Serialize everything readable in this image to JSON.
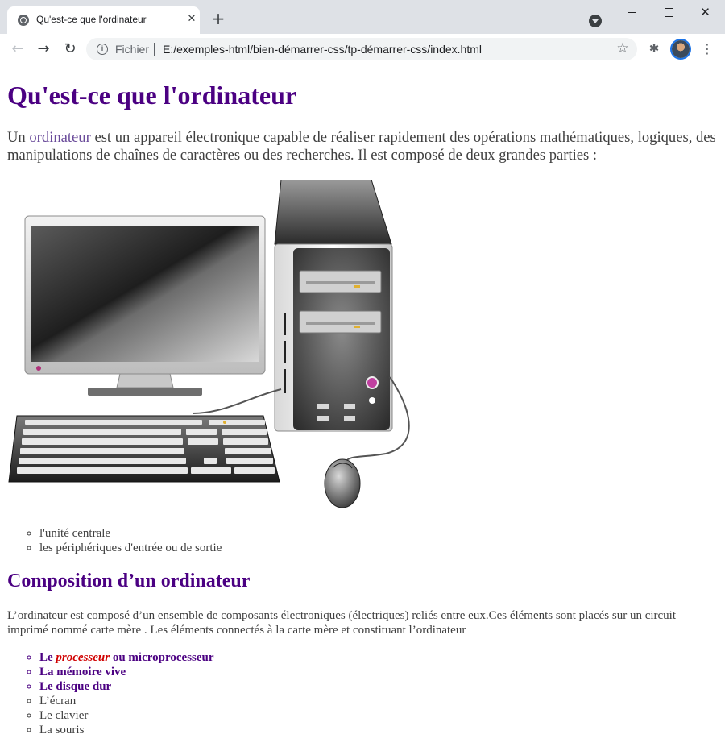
{
  "browser": {
    "tab_title": "Qu'est-ce que l'ordinateur",
    "tab_close": "✕",
    "new_tab": "+",
    "scheme_label": "Fichier",
    "url": "E:/exemples-html/bien-démarrer-css/tp-démarrer-css/index.html",
    "icons": {
      "back": "←",
      "forward": "→",
      "reload": "↻",
      "info": "i",
      "bookmark": "☆",
      "extensions": "✱",
      "menu": "⋮",
      "window_close": "✕"
    }
  },
  "page": {
    "title": "Qu'est-ce que l'ordinateur",
    "intro": {
      "prefix": "Un ",
      "link": "ordinateur",
      "suffix": " est un appareil électronique capable de réaliser rapidement des opérations mathématiques, logiques, des manipulations de chaînes de caractères ou des recherches. Il est composé de deux grandes parties :"
    },
    "parts": [
      "l'unité centrale",
      "les périphériques d'entrée ou de sortie"
    ],
    "composition": {
      "heading": "Composition d’un ordinateur",
      "text": "L’ordinateur est composé d’un ensemble de composants électroniques (électriques) reliés entre eux.Ces éléments sont placés sur un circuit imprimé nommé carte mère . Les éléments connectés à la carte mère et constituant l’ordinateur",
      "processor": {
        "prefix": "Le ",
        "emphasis": "processeur",
        "suffix": " ou microprocesseur"
      },
      "items_bold": [
        "La mémoire vive",
        "Le disque dur"
      ],
      "items": [
        "L’écran",
        "Le clavier",
        "La souris"
      ]
    }
  },
  "colors": {
    "heading": "#4b0082",
    "text": "#404040",
    "link": "#6a4b9a",
    "emphasis": "#d00000",
    "chrome_bg": "#dee1e6"
  }
}
